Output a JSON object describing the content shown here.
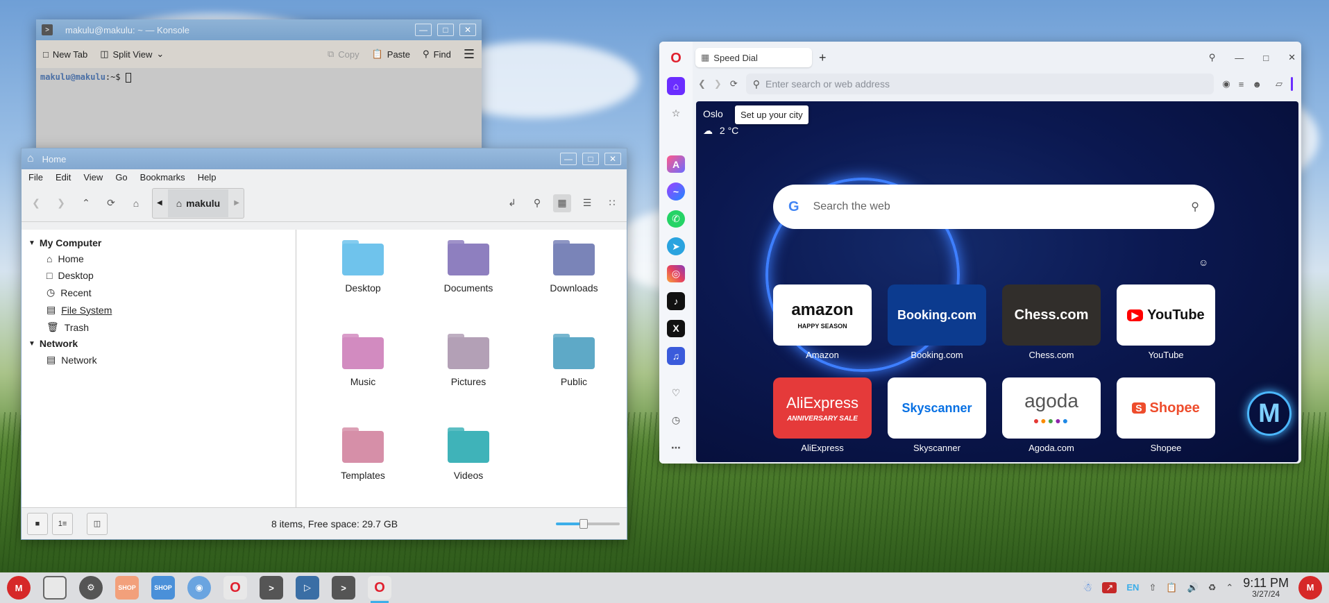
{
  "konsole": {
    "title": "makulu@makulu: ~ — Konsole",
    "toolbar": {
      "new_tab": "New Tab",
      "split_view": "Split View",
      "copy": "Copy",
      "paste": "Paste",
      "find": "Find"
    },
    "prompt_user": "makulu@makulu",
    "prompt_rest": ":~$"
  },
  "filemanager": {
    "title": "Home",
    "menu": [
      "File",
      "Edit",
      "View",
      "Go",
      "Bookmarks",
      "Help"
    ],
    "path": "makulu",
    "sidebar": {
      "section1": "My Computer",
      "items1": [
        "Home",
        "Desktop",
        "Recent",
        "File System",
        "Trash"
      ],
      "section2": "Network",
      "items2": [
        "Network"
      ]
    },
    "files": [
      {
        "name": "Desktop",
        "color": "#6fc3ec"
      },
      {
        "name": "Documents",
        "color": "#8e7fbf"
      },
      {
        "name": "Downloads",
        "color": "#7a84b8"
      },
      {
        "name": "Music",
        "color": "#d28bc0"
      },
      {
        "name": "Pictures",
        "color": "#b3a0b6"
      },
      {
        "name": "Public",
        "color": "#5ea9c7"
      },
      {
        "name": "Templates",
        "color": "#d68fa8"
      },
      {
        "name": "Videos",
        "color": "#3fb3b9"
      }
    ],
    "status": "8 items, Free space: 29.7 GB",
    "zoom_level": 0.4
  },
  "opera": {
    "tab_title": "Speed Dial",
    "address_placeholder": "Enter search or web address",
    "weather": {
      "city": "Oslo",
      "temp": "2 °C",
      "tooltip": "Set up your city"
    },
    "search_placeholder": "Search the web",
    "tiles": [
      {
        "logo": "amazon",
        "label": "Amazon",
        "bg": "#ffffff",
        "fg": "#111111"
      },
      {
        "logo": "Booking.com",
        "label": "Booking.com",
        "bg": "#0c3b8f",
        "fg": "#ffffff"
      },
      {
        "logo": "Chess.com",
        "label": "Chess.com",
        "bg": "#312e2b",
        "fg": "#ffffff"
      },
      {
        "logo": "YouTube",
        "label": "YouTube",
        "bg": "#ffffff",
        "fg": "#111111"
      },
      {
        "logo": "AliExpress",
        "label": "AliExpress",
        "bg": "#e53a3a",
        "fg": "#ffffff"
      },
      {
        "logo": "Skyscanner",
        "label": "Skyscanner",
        "bg": "#ffffff",
        "fg": "#0770e3"
      },
      {
        "logo": "agoda",
        "label": "Agoda.com",
        "bg": "#ffffff",
        "fg": "#555555"
      },
      {
        "logo": "Shopee",
        "label": "Shopee",
        "bg": "#ffffff",
        "fg": "#ee4d2d"
      }
    ],
    "amazon_sub": "HAPPY SEASON",
    "aliexpress_sub": "ANNIVERSARY SALE"
  },
  "taskbar": {
    "lang": "EN",
    "time": "9:11 PM",
    "date": "3/27/24"
  },
  "colors": {
    "accent": "#3daee9",
    "opera_red": "#e0212f",
    "opera_purple": "#6b2dff"
  }
}
